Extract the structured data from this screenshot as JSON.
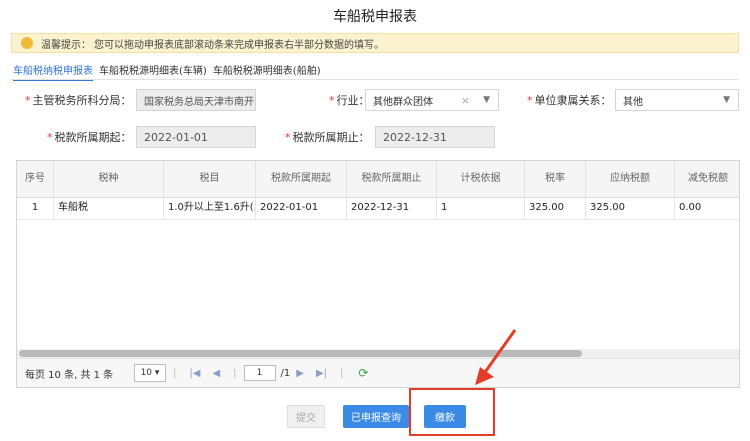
{
  "page_title": "车船税申报表",
  "notice": {
    "label": "温馨提示：",
    "text": "您可以拖动申报表底部滚动条来完成申报表右半部分数据的填写。",
    "icon": "warning-icon"
  },
  "tabs": [
    {
      "label": "车船税纳税申报表"
    },
    {
      "label": "车船税税源明细表(车辆)"
    },
    {
      "label": "车船税税源明细表(船舶)"
    }
  ],
  "form": {
    "tax_office": {
      "label": "主管税务所科分局：",
      "value": "国家税务总局天津市南开区税"
    },
    "industry": {
      "label": "行业：",
      "value": "其他群众团体"
    },
    "affiliation": {
      "label": "单位隶属关系：",
      "value": "其他"
    },
    "period_start": {
      "label": "税款所属期起：",
      "value": "2022-01-01"
    },
    "period_end": {
      "label": "税款所属期止：",
      "value": "2022-12-31"
    }
  },
  "table": {
    "columns": [
      "序号",
      "税种",
      "税目",
      "税款所属期起",
      "税款所属期止",
      "计税依据",
      "税率",
      "应纳税额",
      "减免税额"
    ],
    "rows": [
      [
        "1",
        "车船税",
        "1.0升以上至1.6升(...",
        "2022-01-01",
        "2022-12-31",
        "1",
        "325.00",
        "325.00",
        "0.00"
      ]
    ]
  },
  "pager": {
    "info": "每页 10 条, 共 1 条",
    "page_size": "10",
    "current_page": "1",
    "total_pages": "/1"
  },
  "buttons": {
    "submit": "提交",
    "query": "已申报查询",
    "pay": "缴款"
  },
  "colors": {
    "primary": "#3b8be6",
    "highlight": "#e53c2a",
    "notice_bg": "#fdf2cf"
  }
}
